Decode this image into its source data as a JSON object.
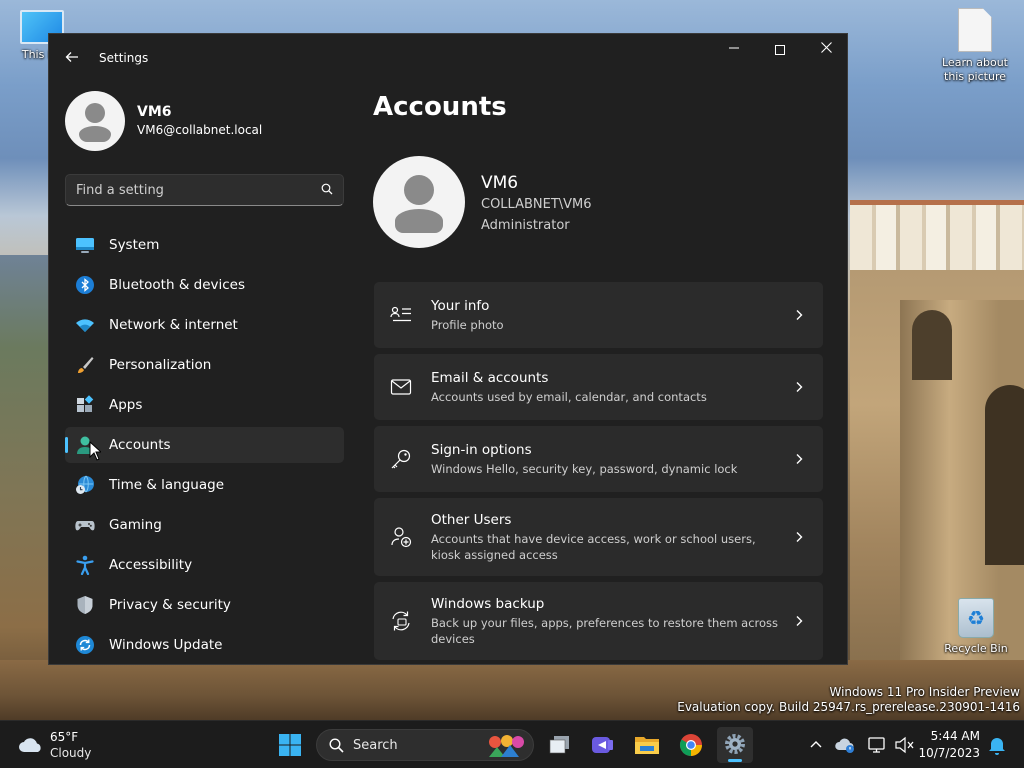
{
  "desktop": {
    "icons": [
      {
        "label": "This PC"
      },
      {
        "label": "Learn about this picture"
      },
      {
        "label": "Recycle Bin"
      }
    ],
    "watermark": {
      "line1": "Windows 11 Pro Insider Preview",
      "line2": "Evaluation copy. Build 25947.rs_prerelease.230901-1416"
    }
  },
  "window": {
    "title": "Settings",
    "controls": {
      "minimize": "minimize-icon",
      "maximize": "maximize-icon",
      "close": "close-icon"
    }
  },
  "sidebar": {
    "profile": {
      "name": "VM6",
      "email": "VM6@collabnet.local"
    },
    "search": {
      "placeholder": "Find a setting",
      "value": ""
    },
    "items": [
      {
        "label": "System",
        "icon": "system-icon",
        "active": false
      },
      {
        "label": "Bluetooth & devices",
        "icon": "bluetooth-icon",
        "active": false
      },
      {
        "label": "Network & internet",
        "icon": "wifi-icon",
        "active": false
      },
      {
        "label": "Personalization",
        "icon": "brush-icon",
        "active": false
      },
      {
        "label": "Apps",
        "icon": "apps-icon",
        "active": false
      },
      {
        "label": "Accounts",
        "icon": "accounts-icon",
        "active": true
      },
      {
        "label": "Time & language",
        "icon": "globe-clock-icon",
        "active": false
      },
      {
        "label": "Gaming",
        "icon": "gamepad-icon",
        "active": false
      },
      {
        "label": "Accessibility",
        "icon": "accessibility-icon",
        "active": false
      },
      {
        "label": "Privacy & security",
        "icon": "shield-icon",
        "active": false
      },
      {
        "label": "Windows Update",
        "icon": "update-icon",
        "active": false
      }
    ]
  },
  "main": {
    "page_title": "Accounts",
    "account": {
      "name": "VM6",
      "domain_user": "COLLABNET\\VM6",
      "role": "Administrator"
    },
    "cards": [
      {
        "title": "Your info",
        "description": "Profile photo",
        "icon": "person-card-icon"
      },
      {
        "title": "Email & accounts",
        "description": "Accounts used by email, calendar, and contacts",
        "icon": "mail-icon"
      },
      {
        "title": "Sign-in options",
        "description": "Windows Hello, security key, password, dynamic lock",
        "icon": "key-icon"
      },
      {
        "title": "Other Users",
        "description": "Accounts that have device access, work or school users, kiosk assigned access",
        "icon": "person-add-icon"
      },
      {
        "title": "Windows backup",
        "description": "Back up your files, apps, preferences to restore them across devices",
        "icon": "backup-icon"
      }
    ]
  },
  "taskbar": {
    "weather": {
      "temp": "65°F",
      "condition": "Cloudy"
    },
    "search_label": "Search",
    "apps": [
      "start-icon",
      "task-view-icon",
      "teams-icon",
      "file-explorer-icon",
      "chrome-icon",
      "settings-icon"
    ],
    "clock": {
      "time": "5:44 AM",
      "date": "10/7/2023"
    }
  },
  "colors": {
    "accent": "#4cc2ff",
    "window_bg": "#202020",
    "card_bg": "#2b2b2b"
  }
}
